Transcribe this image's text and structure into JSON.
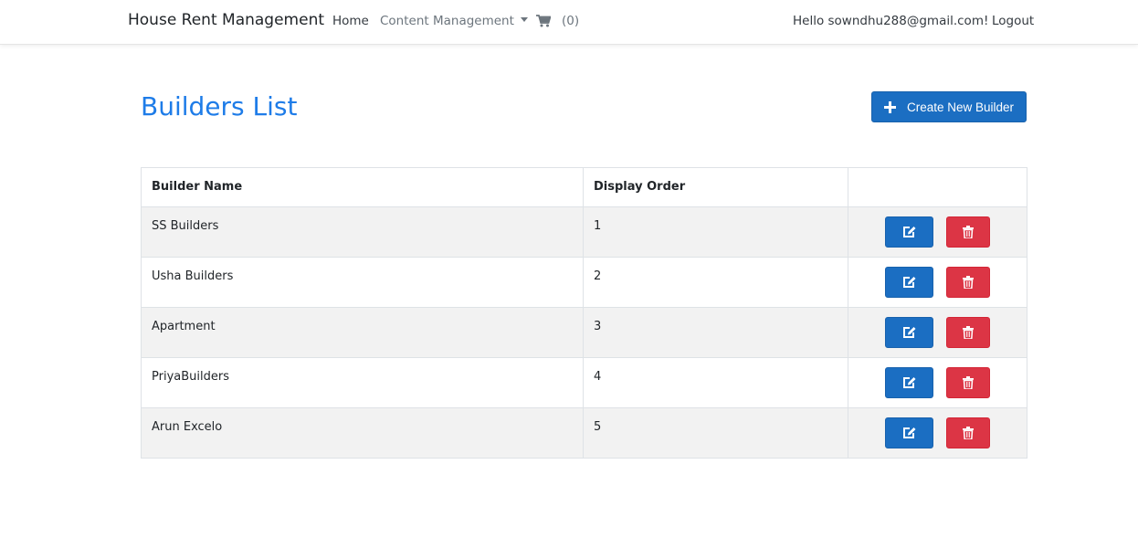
{
  "navbar": {
    "brand": "House Rent Management",
    "home": "Home",
    "content_management": "Content Management",
    "cart_icon": "shopping-cart-icon",
    "cart_count": "(0)",
    "greeting": "Hello sowndhu288@gmail.com!",
    "logout": "Logout"
  },
  "page": {
    "title": "Builders List",
    "create_button": "Create New Builder",
    "create_icon": "plus-icon"
  },
  "table": {
    "headers": [
      "Builder Name",
      "Display Order",
      ""
    ],
    "rows": [
      {
        "name": "SS Builders",
        "order": "1"
      },
      {
        "name": "Usha Builders",
        "order": "2"
      },
      {
        "name": "Apartment",
        "order": "3"
      },
      {
        "name": "PriyaBuilders",
        "order": "4"
      },
      {
        "name": "Arun Excelo",
        "order": "5"
      }
    ],
    "edit_icon": "edit-icon",
    "delete_icon": "trash-icon"
  },
  "colors": {
    "primary": "#1b6ec2",
    "danger": "#dc3545",
    "title": "#1e7ce8",
    "stripe": "#f2f2f2"
  }
}
